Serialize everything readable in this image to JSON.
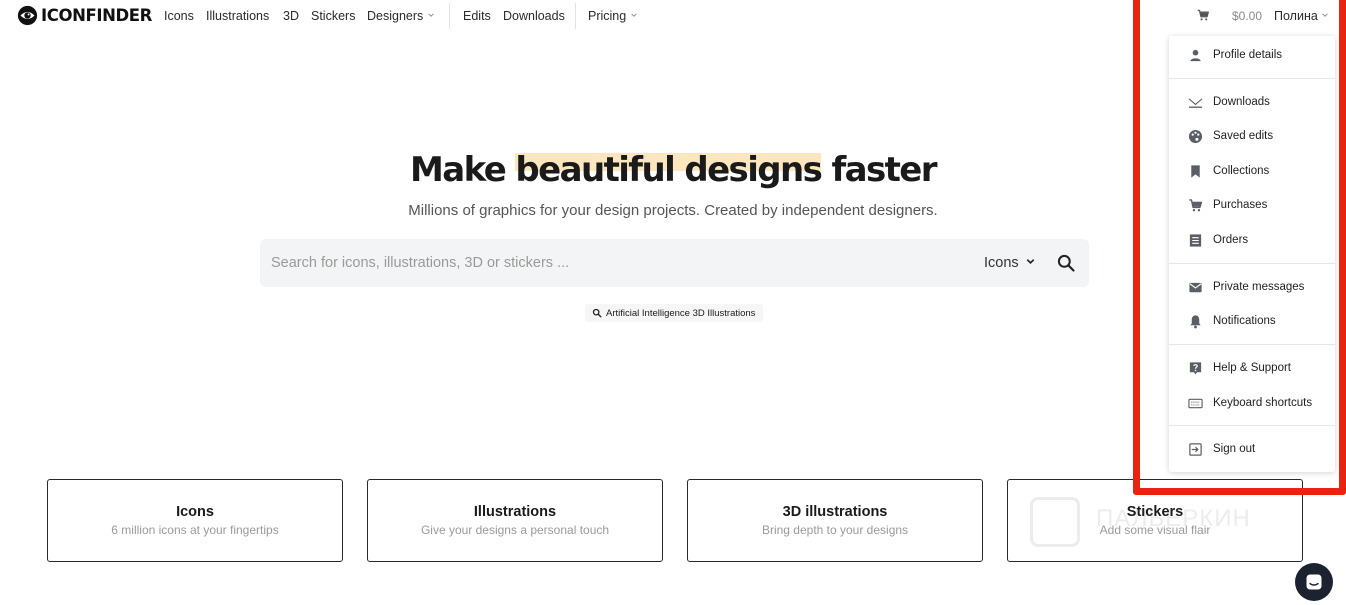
{
  "brand": {
    "name": "ICONFINDER",
    "logo_icon": "eye-logo-icon"
  },
  "nav": {
    "items": [
      {
        "label": "Icons"
      },
      {
        "label": "Illustrations"
      },
      {
        "label": "3D"
      },
      {
        "label": "Stickers"
      },
      {
        "label": "Designers",
        "has_dropdown": true
      },
      {
        "label": "Edits"
      },
      {
        "label": "Downloads"
      },
      {
        "label": "Pricing",
        "has_dropdown": true
      }
    ]
  },
  "header": {
    "cart_icon": "cart-icon",
    "cart_total": "$0.00",
    "user_name": "Полина"
  },
  "hero": {
    "title_before": "Make ",
    "title_highlight": "beautiful designs",
    "title_after": " faster",
    "subtitle": "Millions of graphics for your design projects. Created by independent designers.",
    "search_placeholder": "Search for icons, illustrations, 3D or stickers ...",
    "search_type": "Icons",
    "suggestion": "Artificial Intelligence 3D Illustrations"
  },
  "cards": [
    {
      "title": "Icons",
      "subtitle": "6 million icons at your fingertips"
    },
    {
      "title": "Illustrations",
      "subtitle": "Give your designs a personal touch"
    },
    {
      "title": "3D illustrations",
      "subtitle": "Bring depth to your designs"
    },
    {
      "title": "Stickers",
      "subtitle": "Add some visual flair"
    }
  ],
  "user_dropdown": {
    "items": [
      {
        "label": "Profile details",
        "icon": "person-icon"
      },
      {
        "label": "Downloads",
        "icon": "download-tray-icon"
      },
      {
        "label": "Saved edits",
        "icon": "palette-icon"
      },
      {
        "label": "Collections",
        "icon": "bookmark-icon"
      },
      {
        "label": "Purchases",
        "icon": "cart-icon"
      },
      {
        "label": "Orders",
        "icon": "receipt-icon"
      },
      {
        "label": "Private messages",
        "icon": "envelope-icon"
      },
      {
        "label": "Notifications",
        "icon": "bell-icon"
      },
      {
        "label": "Help & Support",
        "icon": "help-icon"
      },
      {
        "label": "Keyboard shortcuts",
        "icon": "keyboard-icon"
      },
      {
        "label": "Sign out",
        "icon": "sign-out-icon"
      }
    ]
  },
  "watermark": {
    "text": "ПАЛЬЕРКИН"
  },
  "colors": {
    "highlight_border": "#e8230f",
    "hero_highlight": "#fbe6bf",
    "chat_button": "#1c2330"
  }
}
